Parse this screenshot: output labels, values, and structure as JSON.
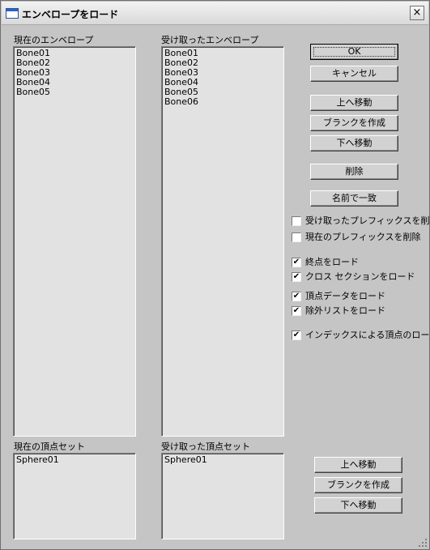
{
  "window": {
    "title": "エンベロープをロード",
    "close_icon": "×"
  },
  "current_envelopes": {
    "label": "現在のエンベロープ",
    "items": [
      "Bone01",
      "Bone02",
      "Bone03",
      "Bone04",
      "Bone05"
    ]
  },
  "received_envelopes": {
    "label": "受け取ったエンベロープ",
    "items": [
      "Bone01",
      "Bone02",
      "Bone03",
      "Bone04",
      "Bone05",
      "Bone06"
    ]
  },
  "buttons": {
    "ok": "OK",
    "cancel": "キャンセル",
    "move_up": "上へ移動",
    "create_blank": "ブランクを作成",
    "move_down": "下へ移動",
    "delete": "削除",
    "match_by_name": "名前で一致"
  },
  "options": [
    {
      "label": "受け取ったプレフィックスを削除",
      "checked": false
    },
    {
      "label": "現在のプレフィックスを削除",
      "checked": false
    },
    {
      "label": "終点をロード",
      "checked": true
    },
    {
      "label": "クロス セクションをロード",
      "checked": true
    },
    {
      "label": "頂点データをロード",
      "checked": true
    },
    {
      "label": "除外リストをロード",
      "checked": true
    },
    {
      "label": "インデックスによる頂点のロード",
      "checked": true
    }
  ],
  "check_mark": "✔",
  "current_vertex_set": {
    "label": "現在の頂点セット",
    "items": [
      "Sphere01"
    ]
  },
  "received_vertex_set": {
    "label": "受け取った頂点セット",
    "items": [
      "Sphere01"
    ]
  },
  "vertex_buttons": {
    "move_up": "上へ移動",
    "create_blank": "ブランクを作成",
    "move_down": "下へ移動"
  }
}
